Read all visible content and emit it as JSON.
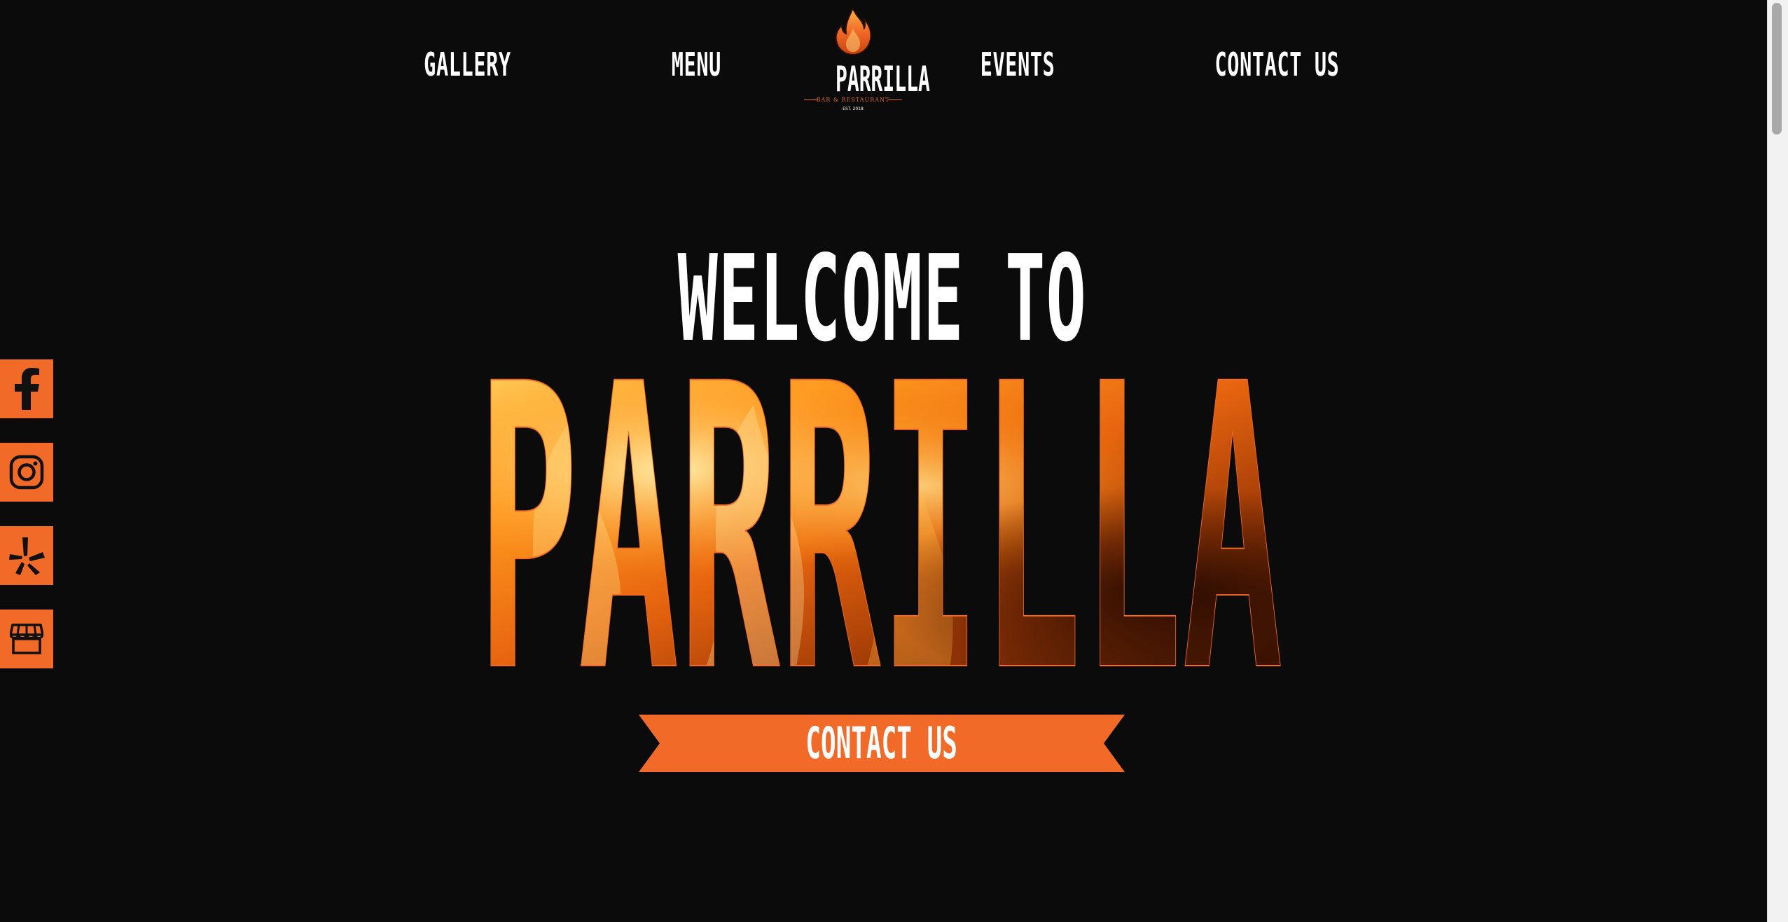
{
  "nav": {
    "gallery_label": "GALLERY",
    "menu_label": "MENU",
    "events_label": "EVENTS",
    "contact_label": "CONTACT US"
  },
  "logo": {
    "wordmark": "PARRILLA",
    "tagline": "BAR & RESTAURANT",
    "established": "EST. 2018",
    "icon": "flame-icon"
  },
  "hero": {
    "welcome": "WELCOME TO",
    "brand": "PARRILLA"
  },
  "cta": {
    "label": "CONTACT US"
  },
  "social": [
    {
      "name": "facebook",
      "icon": "facebook-icon"
    },
    {
      "name": "instagram",
      "icon": "instagram-icon"
    },
    {
      "name": "yelp",
      "icon": "yelp-icon"
    },
    {
      "name": "store",
      "icon": "storefront-icon"
    }
  ],
  "colors": {
    "background": "#0b0b0b",
    "accent": "#f16a27",
    "text": "#ffffff"
  }
}
